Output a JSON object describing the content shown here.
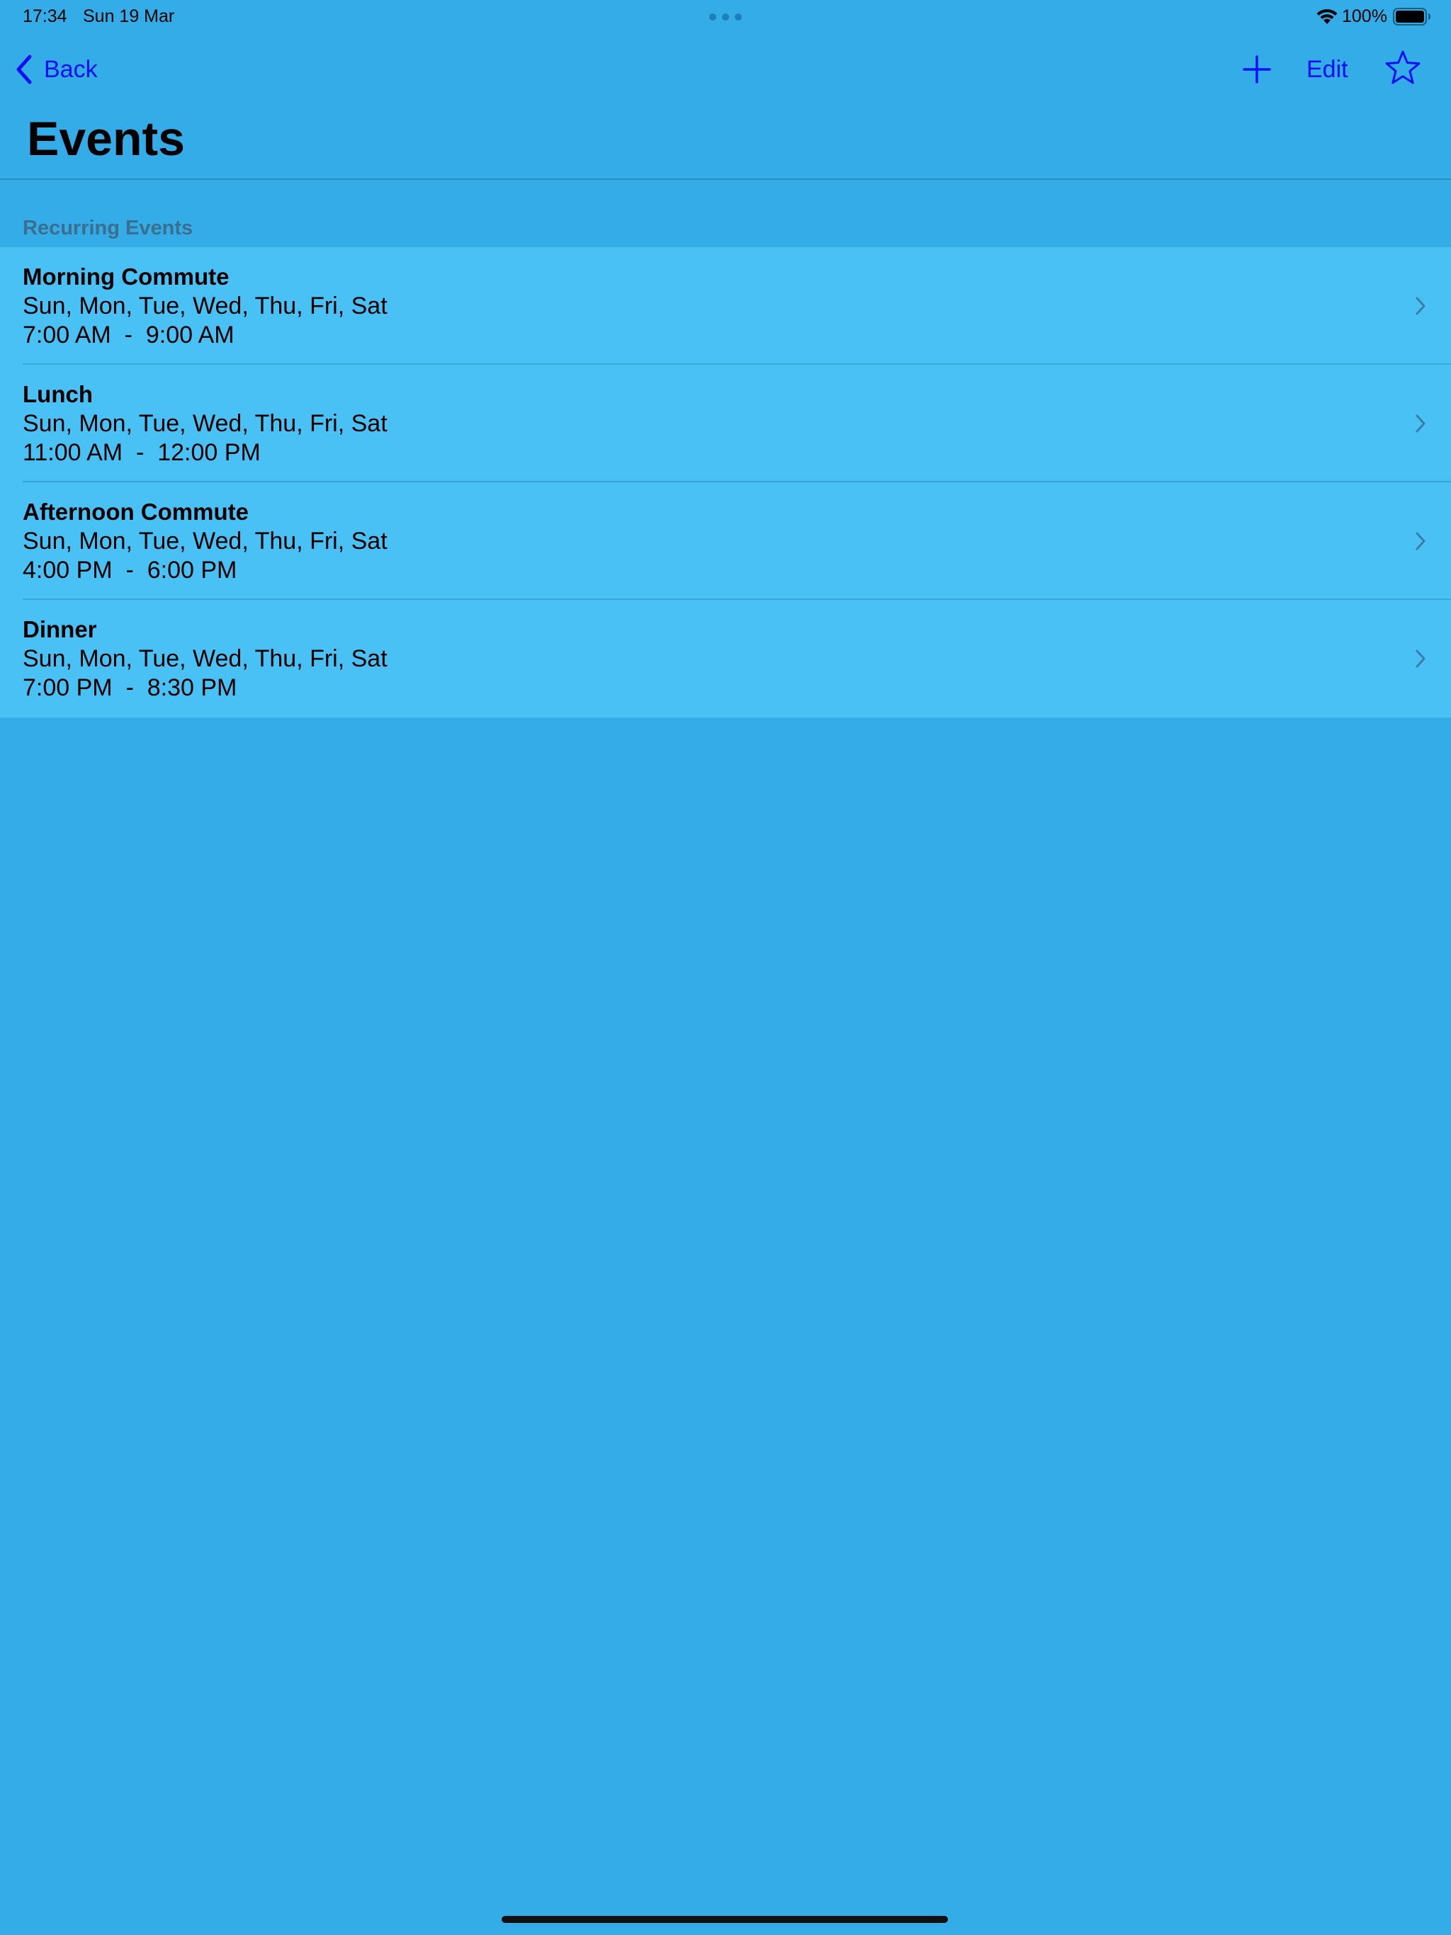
{
  "status_bar": {
    "time": "17:34",
    "date": "Sun 19 Mar",
    "battery_percent": "100%",
    "battery_level": 1.0
  },
  "nav": {
    "back_label": "Back",
    "edit_label": "Edit",
    "title": "Events"
  },
  "section": {
    "header": "Recurring Events"
  },
  "events": [
    {
      "title": "Morning Commute",
      "days": "Sun, Mon, Tue, Wed, Thu, Fri, Sat",
      "time": "7:00 AM  -  9:00 AM"
    },
    {
      "title": "Lunch",
      "days": "Sun, Mon, Tue, Wed, Thu, Fri, Sat",
      "time": "11:00 AM  -  12:00 PM"
    },
    {
      "title": "Afternoon Commute",
      "days": "Sun, Mon, Tue, Wed, Thu, Fri, Sat",
      "time": "4:00 PM  -  6:00 PM"
    },
    {
      "title": "Dinner",
      "days": "Sun, Mon, Tue, Wed, Thu, Fri, Sat",
      "time": "7:00 PM  -  8:30 PM"
    }
  ],
  "colors": {
    "background": "#33ace7",
    "row_background": "#4ac1f4",
    "accent": "#0a10f5",
    "section_header": "#3a6f8f"
  },
  "icons": {
    "back": "chevron-left-icon",
    "add": "plus-icon",
    "favorite": "star-icon",
    "row_disclosure": "chevron-right-icon",
    "wifi": "wifi-icon",
    "battery": "battery-icon",
    "multitask": "more-dots-icon"
  }
}
